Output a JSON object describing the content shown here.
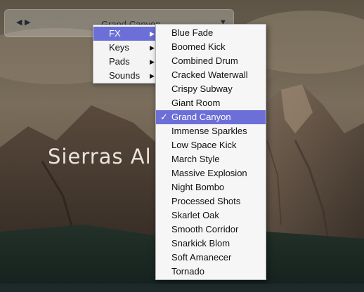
{
  "preset_bar": {
    "prev_icon": "◀",
    "next_icon": "▶",
    "current_preset": "Grand Canyon",
    "dropdown_icon": "▼"
  },
  "background": {
    "title": "Sierras Al"
  },
  "category_menu": {
    "items": [
      {
        "label": "FX",
        "active": true
      },
      {
        "label": "Keys",
        "active": false
      },
      {
        "label": "Pads",
        "active": false
      },
      {
        "label": "Sounds",
        "active": false
      }
    ],
    "submenu_arrow": "▶"
  },
  "fx_submenu": {
    "check_icon": "✓",
    "items": [
      {
        "label": "Blue Fade",
        "selected": false
      },
      {
        "label": "Boomed Kick",
        "selected": false
      },
      {
        "label": "Combined Drum",
        "selected": false
      },
      {
        "label": "Cracked Waterwall",
        "selected": false
      },
      {
        "label": "Crispy Subway",
        "selected": false
      },
      {
        "label": "Giant Room",
        "selected": false
      },
      {
        "label": "Grand Canyon",
        "selected": true
      },
      {
        "label": "Immense Sparkles",
        "selected": false
      },
      {
        "label": "Low Space Kick",
        "selected": false
      },
      {
        "label": "March Style",
        "selected": false
      },
      {
        "label": "Massive Explosion",
        "selected": false
      },
      {
        "label": "Night Bombo",
        "selected": false
      },
      {
        "label": "Processed Shots",
        "selected": false
      },
      {
        "label": "Skarlet Oak",
        "selected": false
      },
      {
        "label": "Smooth Corridor",
        "selected": false
      },
      {
        "label": "Snarkick Blom",
        "selected": false
      },
      {
        "label": "Soft Amanecer",
        "selected": false
      },
      {
        "label": "Tornado",
        "selected": false
      }
    ]
  }
}
